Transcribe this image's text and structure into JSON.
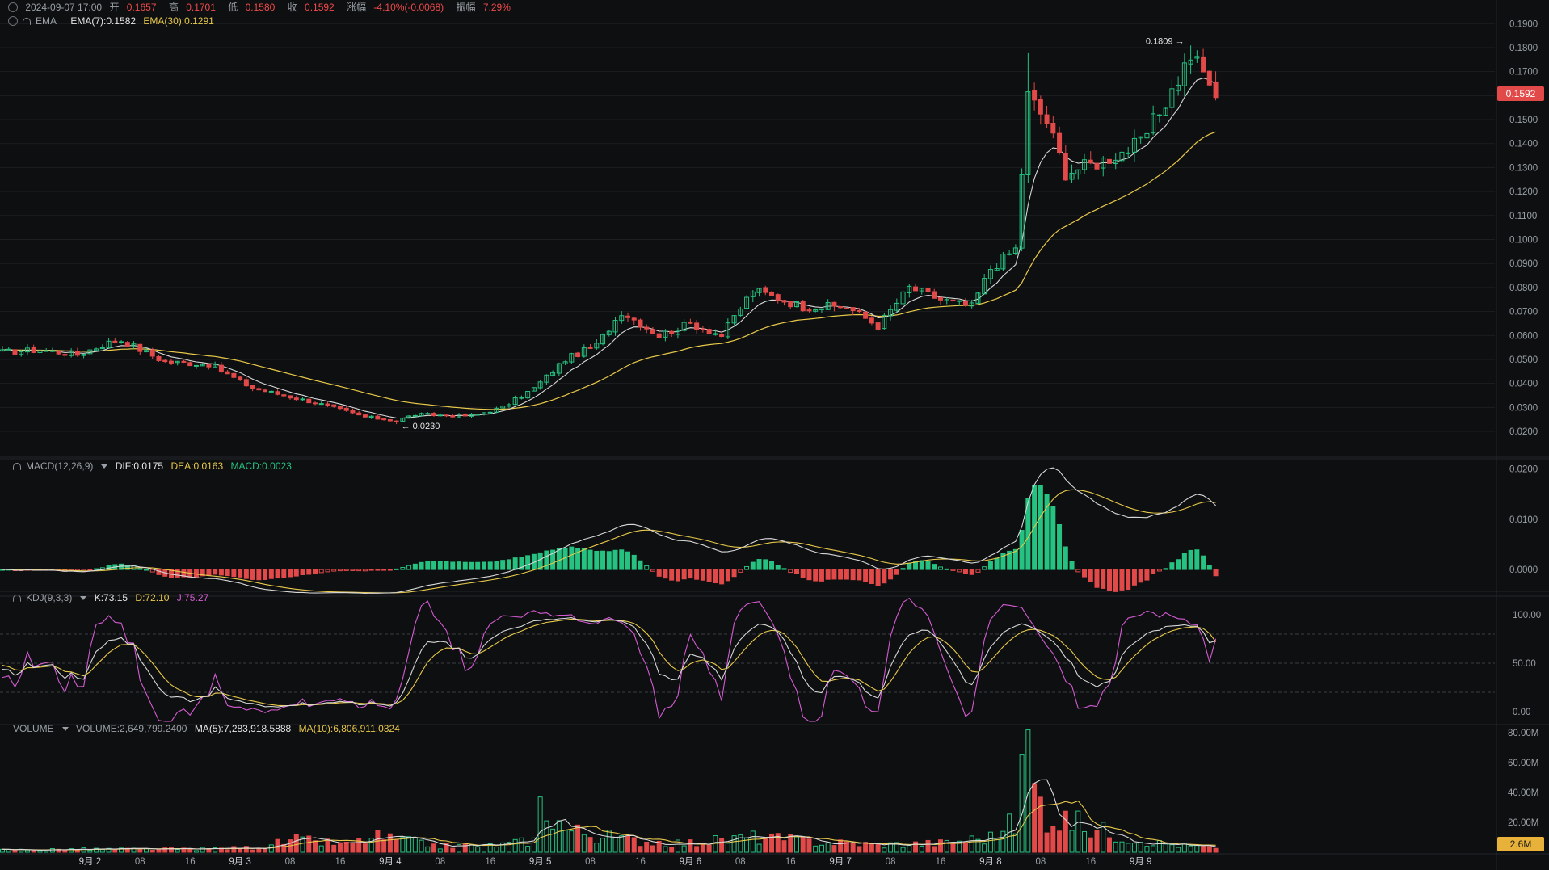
{
  "header": {
    "datetime": "2024-09-07 17:00",
    "open_label": "开",
    "open": "0.1657",
    "high_label": "高",
    "high": "0.1701",
    "low_label": "低",
    "low": "0.1580",
    "close_label": "收",
    "close": "0.1592",
    "change_label": "涨幅",
    "change": "-4.10%(-0.0068)",
    "amp_label": "振幅",
    "amp": "7.29%",
    "ema_name": "EMA",
    "ema7": "EMA(7):0.1582",
    "ema30": "EMA(30):0.1291"
  },
  "macd_header": {
    "name": "MACD(12,26,9)",
    "dif": "DIF:0.0175",
    "dea": "DEA:0.0163",
    "macd": "MACD:0.0023"
  },
  "kdj_header": {
    "name": "KDJ(9,3,3)",
    "k": "K:73.15",
    "d": "D:72.10",
    "j": "J:75.27"
  },
  "vol_header": {
    "name": "VOLUME",
    "vol": "VOLUME:2,649,799.2400",
    "ma5": "MA(5):7,283,918.5888",
    "ma10": "MA(10):6,806,911.0324"
  },
  "last_price_tag": "0.1592",
  "last_volume_tag": "2.6M",
  "colors": {
    "up": "#26c281",
    "down": "#e24949",
    "ema7": "#d8d8d8",
    "ema30": "#e8c94a",
    "k": "#d8d8d8",
    "d": "#e8c94a",
    "j": "#d45bd1",
    "bg": "#0e0f11",
    "grid": "#1c1e22"
  },
  "chart_data": {
    "type": "candlestick",
    "interval": "hourly",
    "price_axis": {
      "ticks": [
        "0.0200",
        "0.0300",
        "0.0400",
        "0.0500",
        "0.0600",
        "0.0700",
        "0.0800",
        "0.0900",
        "0.1000",
        "0.1100",
        "0.1200",
        "0.1300",
        "0.1400",
        "0.1500",
        "0.1600",
        "0.1700",
        "0.1800",
        "0.1900"
      ],
      "range": [
        0.0153,
        0.1975
      ]
    },
    "macd_axis": {
      "ticks": [
        "0.0000",
        "0.0100",
        "0.0200"
      ],
      "range": [
        -0.004,
        0.022
      ]
    },
    "kdj_axis": {
      "ticks": [
        "0.00",
        "50.00",
        "100.00"
      ],
      "range": [
        -10,
        120
      ],
      "dashed": [
        20,
        50,
        80
      ]
    },
    "volume_axis": {
      "ticks": [
        "20.00M",
        "40.00M",
        "60.00M",
        "80.00M"
      ],
      "max": 85000000
    },
    "x_ticks": [
      "9月 2",
      "08",
      "16",
      "9月 3",
      "08",
      "16",
      "9月 4",
      "08",
      "16",
      "9月 5",
      "08",
      "16",
      "9月 6",
      "08",
      "16",
      "9月 7",
      "08",
      "16",
      "9月 8",
      "08",
      "16",
      "9月 9"
    ],
    "annotations": {
      "max": "0.1809 →",
      "min": "← 0.0230"
    },
    "close_anchors": [
      [
        0,
        0.053
      ],
      [
        6,
        0.054
      ],
      [
        12,
        0.052
      ],
      [
        17,
        0.057
      ],
      [
        19,
        0.058
      ],
      [
        26,
        0.049
      ],
      [
        33,
        0.048
      ],
      [
        40,
        0.038
      ],
      [
        50,
        0.032
      ],
      [
        58,
        0.026
      ],
      [
        63,
        0.0245
      ],
      [
        66,
        0.027
      ],
      [
        75,
        0.0265
      ],
      [
        80,
        0.03
      ],
      [
        85,
        0.038
      ],
      [
        90,
        0.05
      ],
      [
        95,
        0.056
      ],
      [
        99,
        0.07
      ],
      [
        105,
        0.06
      ],
      [
        110,
        0.065
      ],
      [
        115,
        0.06
      ],
      [
        120,
        0.079
      ],
      [
        128,
        0.072
      ],
      [
        135,
        0.072
      ],
      [
        140,
        0.064
      ],
      [
        145,
        0.08
      ],
      [
        150,
        0.075
      ],
      [
        155,
        0.072
      ],
      [
        158,
        0.088
      ],
      [
        162,
        0.096
      ],
      [
        164,
        0.16
      ],
      [
        167,
        0.149
      ],
      [
        170,
        0.128
      ],
      [
        175,
        0.132
      ],
      [
        182,
        0.14
      ],
      [
        187,
        0.162
      ],
      [
        190,
        0.177
      ],
      [
        193,
        0.1657
      ],
      [
        194,
        0.1592
      ]
    ],
    "volume_anchors": [
      [
        0,
        1.5
      ],
      [
        12,
        2.0
      ],
      [
        30,
        2.0
      ],
      [
        40,
        3.0
      ],
      [
        47,
        8.0
      ],
      [
        55,
        5.0
      ],
      [
        60,
        10.0
      ],
      [
        70,
        4.0
      ],
      [
        80,
        5.0
      ],
      [
        85,
        8.0
      ],
      [
        86,
        37.0
      ],
      [
        90,
        15.0
      ],
      [
        100,
        8.0
      ],
      [
        110,
        6.0
      ],
      [
        120,
        10.0
      ],
      [
        130,
        7.0
      ],
      [
        140,
        5.0
      ],
      [
        150,
        6.0
      ],
      [
        158,
        10.0
      ],
      [
        162,
        20.0
      ],
      [
        164,
        82.0
      ],
      [
        165,
        46.0
      ],
      [
        167,
        25.0
      ],
      [
        175,
        15.0
      ],
      [
        185,
        6.0
      ],
      [
        194,
        2.6
      ]
    ]
  }
}
